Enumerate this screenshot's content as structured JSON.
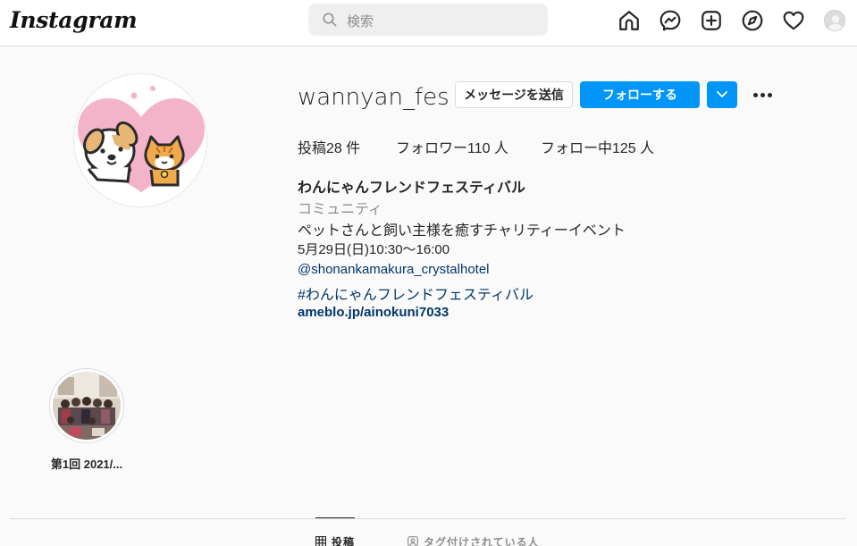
{
  "header": {
    "logo": "Instagram",
    "search_placeholder": "検索",
    "icons": [
      "home-icon",
      "messenger-icon",
      "new-post-icon",
      "explore-icon",
      "activity-heart-icon",
      "profile-avatar-icon"
    ]
  },
  "profile": {
    "username": "wannyan_fes",
    "message_button": "メッセージを送信",
    "follow_button": "フォローする",
    "stats": {
      "posts": "投稿28 件",
      "followers": "フォロワー110 人",
      "following": "フォロー中125 人"
    },
    "bio": {
      "name": "わんにゃんフレンドフェスティバル",
      "category": "コミュニティ",
      "line1": "ペットさんと飼い主様を癒すチャリティーイベント",
      "line2": "5月29日(日)10:30〜16:00",
      "mention": "@shonankamakura_crystalhotel",
      "hashtag": "#わんにゃんフレンドフェスティバル",
      "website": "ameblo.jp/ainokuni7033"
    }
  },
  "highlights": [
    {
      "label": "第1回 2021/..."
    }
  ],
  "tabs": {
    "posts": "投稿",
    "tagged": "タグ付けされている人"
  },
  "colors": {
    "accent": "#0095f6",
    "link": "#00376b",
    "muted": "#8e8e8e",
    "heart_pink": "#f3b4c9"
  }
}
